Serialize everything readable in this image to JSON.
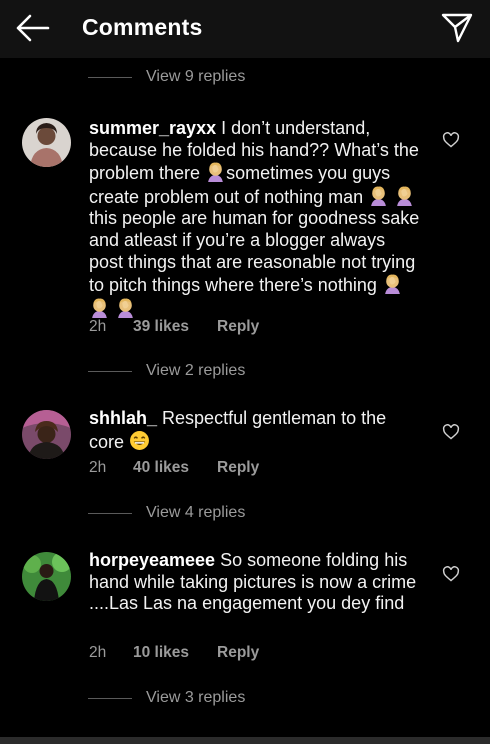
{
  "header": {
    "title": "Comments"
  },
  "threads": [
    {
      "replies": "View 9 replies"
    },
    {
      "replies": "View 2 replies"
    },
    {
      "replies": "View 4 replies"
    },
    {
      "replies": "View 3 replies"
    }
  ],
  "comments": [
    {
      "username": "summer_rayxx",
      "text_parts": [
        " I don’t understand, because he folded his hand?? What’s the problem there ",
        "sometimes you guys create problem out of nothing man ",
        " this people are human for goodness sake and atleast if you’re a blogger always post things that are reasonable not trying to pitch things where there’s nothing "
      ],
      "time": "2h",
      "likes": "39 likes",
      "reply": "Reply"
    },
    {
      "username": "shhlah_",
      "text": " Respectful gentleman to the core ",
      "time": "2h",
      "likes": "40 likes",
      "reply": "Reply"
    },
    {
      "username": "horpeyeameee",
      "text": " So someone folding his hand while taking pictures is now a crime ....Las Las na engagement you dey find",
      "time": "2h",
      "likes": "10 likes",
      "reply": "Reply"
    }
  ],
  "icons": {
    "back": "arrow-left-icon",
    "send": "paper-plane-icon",
    "like": "heart-outline-icon",
    "facepalm": "facepalm-emoji",
    "grin": "grinning-emoji"
  }
}
